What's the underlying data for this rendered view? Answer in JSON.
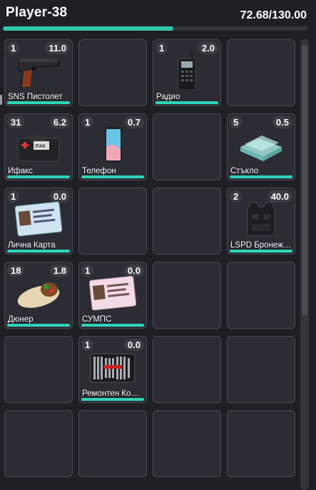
{
  "header": {
    "player_name": "Player-38",
    "weight_text": "72.68/130.00",
    "weight_current": 72.68,
    "weight_max": 130.0
  },
  "colors": {
    "accent": "#2fd4b9",
    "background": "#1f2026",
    "slot_bg": "#2c2d34",
    "slot_border": "#474852"
  },
  "slots": [
    {
      "qty": "1",
      "weight": "11.0",
      "name": "SNS Пистолет",
      "icon": "pistol-icon"
    },
    {},
    {
      "qty": "1",
      "weight": "2.0",
      "name": "Радио",
      "icon": "radio-icon"
    },
    {},
    {
      "qty": "31",
      "weight": "6.2",
      "name": "Ифакс",
      "icon": "first-aid-kit-icon"
    },
    {
      "qty": "1",
      "weight": "0.7",
      "name": "Телефон",
      "icon": "phone-icon"
    },
    {},
    {
      "qty": "5",
      "weight": "0.5",
      "name": "Стъкло",
      "icon": "glass-icon"
    },
    {
      "qty": "1",
      "weight": "0.0",
      "name": "Лична Карта",
      "icon": "id-card-icon"
    },
    {},
    {},
    {
      "qty": "2",
      "weight": "40.0",
      "name": "LSPD Бронежилетка",
      "icon": "body-armor-icon"
    },
    {
      "qty": "18",
      "weight": "1.8",
      "name": "Дюнер",
      "icon": "wrap-icon"
    },
    {
      "qty": "1",
      "weight": "0.0",
      "name": "СУМПС",
      "icon": "license-card-icon"
    },
    {},
    {},
    {},
    {
      "qty": "1",
      "weight": "0.0",
      "name": "Ремонтен Комплект",
      "icon": "toolkit-icon"
    },
    {},
    {},
    {},
    {},
    {},
    {}
  ]
}
